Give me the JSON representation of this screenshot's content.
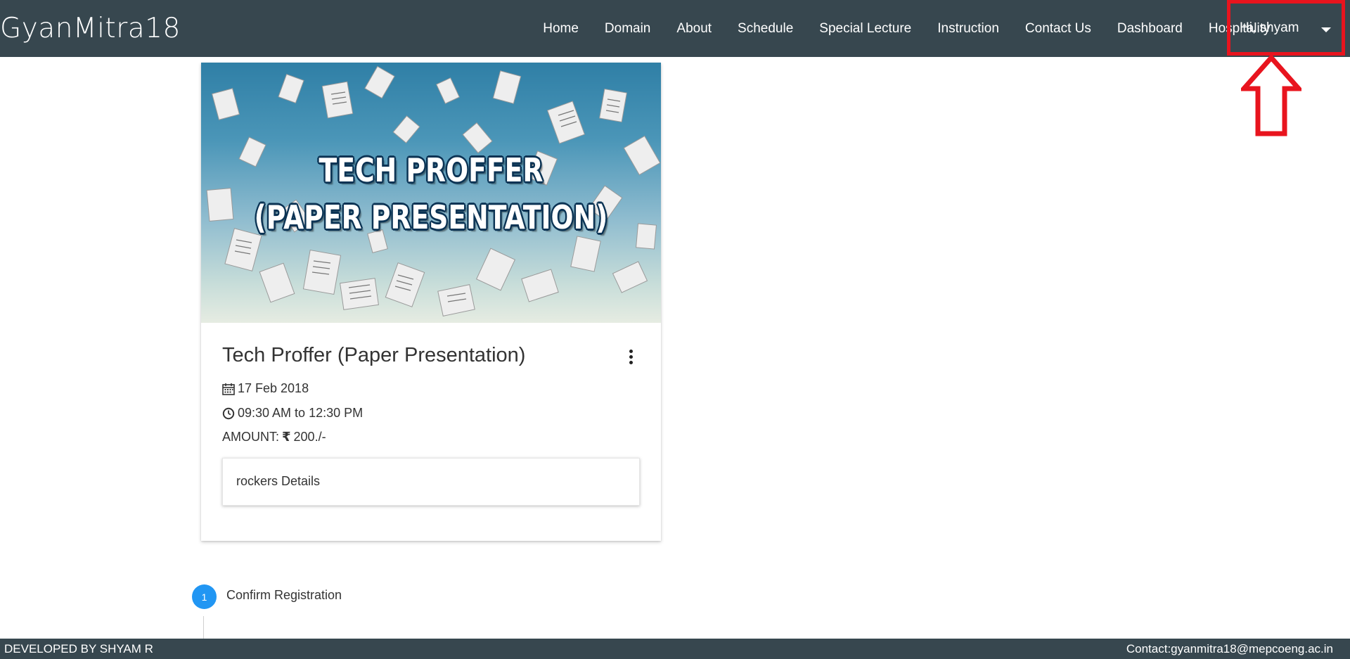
{
  "navbar": {
    "brand": "GyanMitra18",
    "items": [
      {
        "label": "Home"
      },
      {
        "label": "Domain"
      },
      {
        "label": "About"
      },
      {
        "label": "Schedule"
      },
      {
        "label": "Special Lecture"
      },
      {
        "label": "Instruction"
      },
      {
        "label": "Contact Us"
      },
      {
        "label": "Dashboard"
      },
      {
        "label": "Hospitality"
      }
    ],
    "user_label": "Hi, shyam",
    "user_caret_icon": "caret-down-icon"
  },
  "annotation": {
    "highlight_color": "#e8141e",
    "arrow_icon": "up-arrow-icon"
  },
  "event_card": {
    "banner_line1": "TECH PROFFER",
    "banner_line2": "(PAPER PRESENTATION)",
    "title": "Tech Proffer (Paper Presentation)",
    "date": "17 Feb 2018",
    "time": "09:30 AM to 12:30 PM",
    "amount_label": "AMOUNT:",
    "currency_symbol": "₹",
    "amount_value": "200./-",
    "details_label": "rockers Details",
    "icons": {
      "date": "calendar-icon",
      "time": "clock-icon",
      "more": "more-vert-icon"
    }
  },
  "stepper": {
    "steps": [
      {
        "number": "1",
        "label": "Confirm Registration",
        "color": "#2196f3"
      }
    ]
  },
  "footer": {
    "left": "DEVELOPED BY SHYAM R",
    "right": "Contact:gyanmitra18@mepcoeng.ac.in"
  },
  "colors": {
    "navbar_bg": "#37474f",
    "accent": "#2196f3"
  }
}
